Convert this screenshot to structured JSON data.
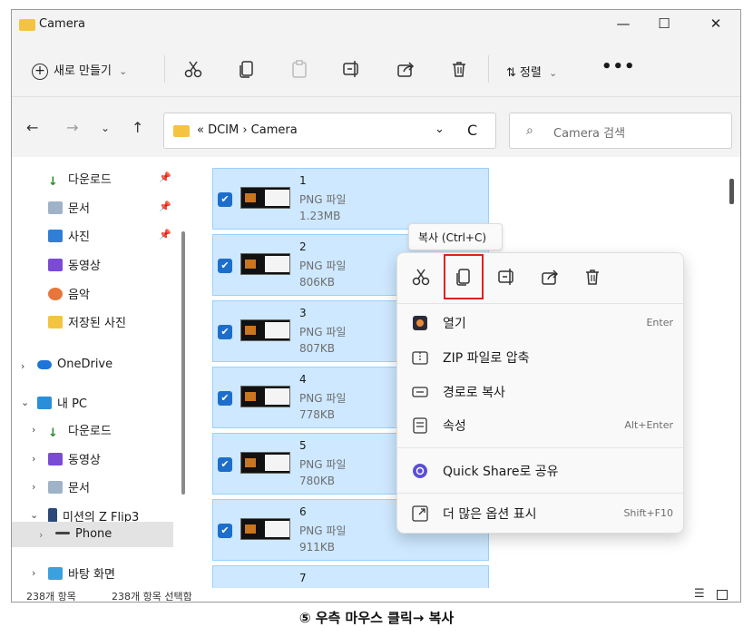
{
  "window": {
    "title": "Camera",
    "minimize": "—",
    "maximize": "☐",
    "close": "✕"
  },
  "toolbar": {
    "new_label": "새로 만들기",
    "new_chevron": "⌄",
    "sort_label": "정렬",
    "sort_chevron": "⌄",
    "more": "•••"
  },
  "nav": {
    "back": "←",
    "forward": "→",
    "recent": "⌄",
    "up": "↑"
  },
  "address": {
    "path": "« DCIM  ›  Camera",
    "dropdown": "⌄",
    "refresh": "C"
  },
  "search": {
    "placeholder": "Camera 검색",
    "icon": "⌕"
  },
  "sidebar": {
    "quick": [
      {
        "label": "다운로드",
        "pin": "📌"
      },
      {
        "label": "문서",
        "pin": "📌"
      },
      {
        "label": "사진",
        "pin": "📌"
      },
      {
        "label": "동영상"
      },
      {
        "label": "음악"
      },
      {
        "label": "저장된 사진"
      }
    ],
    "onedrive": "OneDrive",
    "thispc": "내 PC",
    "pc_items": [
      "다운로드",
      "동영상",
      "문서",
      "미션의 Z Flip3"
    ],
    "phone": "Phone",
    "desktop": "바탕 화면",
    "arrow_right": "›",
    "arrow_down": "⌄"
  },
  "files": [
    {
      "name": "1",
      "type": "PNG 파일",
      "size": "1.23MB"
    },
    {
      "name": "2",
      "type": "PNG 파일",
      "size": "806KB"
    },
    {
      "name": "3",
      "type": "PNG 파일",
      "size": "807KB"
    },
    {
      "name": "4",
      "type": "PNG 파일",
      "size": "778KB"
    },
    {
      "name": "5",
      "type": "PNG 파일",
      "size": "780KB"
    },
    {
      "name": "6",
      "type": "PNG 파일",
      "size": "911KB"
    },
    {
      "name": "7"
    }
  ],
  "checkmark": "✔",
  "tooltip": "복사 (Ctrl+C)",
  "context_menu": {
    "items": [
      {
        "label": "열기",
        "shortcut": "Enter"
      },
      {
        "label": "ZIP 파일로 압축",
        "shortcut": ""
      },
      {
        "label": "경로로 복사",
        "shortcut": ""
      },
      {
        "label": "속성",
        "shortcut": "Alt+Enter"
      },
      {
        "label": "Quick Share로 공유",
        "shortcut": ""
      },
      {
        "label": "더 많은 옵션 표시",
        "shortcut": "Shift+F10"
      }
    ]
  },
  "status": {
    "count": "238개 항목",
    "selected": "238개 항목 선택함"
  },
  "caption": "⑤ 우측 마우스 클릭→ 복사",
  "colors": {
    "selection": "#cde8ff",
    "accent": "#1d6ecb",
    "highlight_box": "#e02020"
  }
}
